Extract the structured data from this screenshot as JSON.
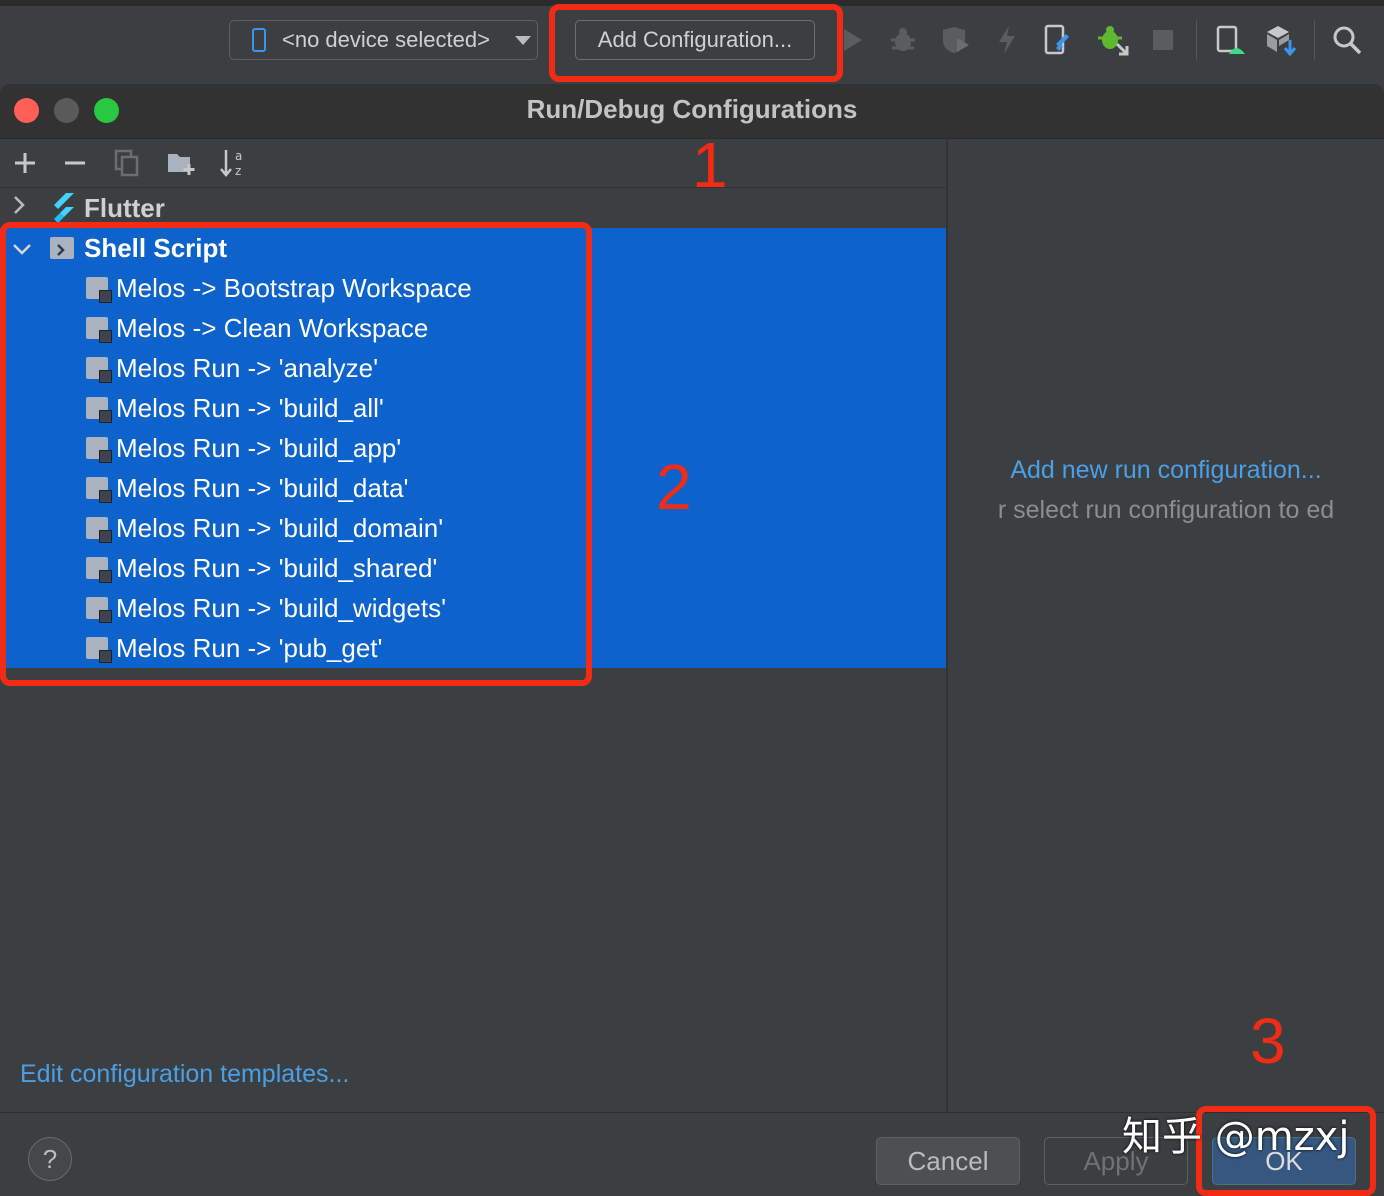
{
  "toolbar": {
    "device_selector": "<no device selected>",
    "add_configuration": "Add Configuration..."
  },
  "dialog": {
    "title": "Run/Debug Configurations",
    "tree": {
      "flutter_group": "Flutter",
      "shell_group": "Shell Script",
      "items": [
        "Melos -> Bootstrap Workspace",
        "Melos -> Clean Workspace",
        "Melos Run -> 'analyze'",
        "Melos Run -> 'build_all'",
        "Melos Run -> 'build_app'",
        "Melos Run -> 'build_data'",
        "Melos Run -> 'build_domain'",
        "Melos Run -> 'build_shared'",
        "Melos Run -> 'build_widgets'",
        "Melos Run -> 'pub_get'"
      ]
    },
    "edit_templates": "Edit configuration templates...",
    "right_panel": {
      "link": "Add new run configuration...",
      "hint": "r select run configuration to ed"
    },
    "buttons": {
      "help": "?",
      "cancel": "Cancel",
      "apply": "Apply",
      "ok": "OK"
    }
  },
  "annotations": {
    "step1": "1",
    "step2": "2",
    "step3": "3"
  },
  "watermark": "知乎 @mzxj",
  "colors": {
    "selection": "#0d62cc",
    "link": "#4a9fe6",
    "annotation": "#f22b14",
    "background": "#3c3f41"
  }
}
